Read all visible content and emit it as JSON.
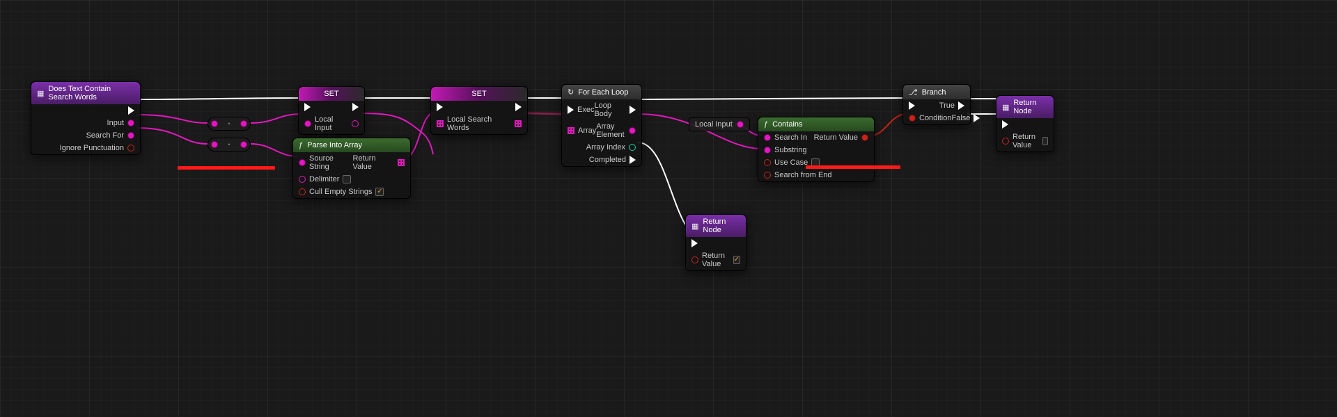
{
  "nodes": {
    "entry": {
      "title": "Does Text Contain Search Words",
      "pins": {
        "input": "Input",
        "search_for": "Search For",
        "ignore_punct": "Ignore Punctuation"
      }
    },
    "set1": {
      "title": "SET",
      "var": "Local Input"
    },
    "set2": {
      "title": "SET",
      "var": "Local Search Words"
    },
    "parse": {
      "title": "Parse Into Array",
      "pins": {
        "source": "Source String",
        "delimiter": "Delimiter",
        "cull": "Cull Empty Strings",
        "ret": "Return Value"
      },
      "cull_checked": true
    },
    "foreach": {
      "title": "For Each Loop",
      "pins": {
        "exec": "Exec",
        "array": "Array",
        "loop_body": "Loop Body",
        "elem": "Array Element",
        "idx": "Array Index",
        "done": "Completed"
      }
    },
    "local_input_get": {
      "label": "Local Input"
    },
    "contains": {
      "title": "Contains",
      "pins": {
        "search_in": "Search In",
        "substring": "Substring",
        "use_case": "Use Case",
        "from_end": "Search from End",
        "ret": "Return Value"
      },
      "use_case_checked": false,
      "from_end_checked": false
    },
    "branch": {
      "title": "Branch",
      "pins": {
        "cond": "Condition",
        "t": "True",
        "f": "False"
      }
    },
    "return_true": {
      "title": "Return Node",
      "pins": {
        "ret": "Return Value"
      },
      "checked": true
    },
    "return_false": {
      "title": "Return Node",
      "pins": {
        "ret": "Return Value"
      },
      "checked": false
    }
  }
}
